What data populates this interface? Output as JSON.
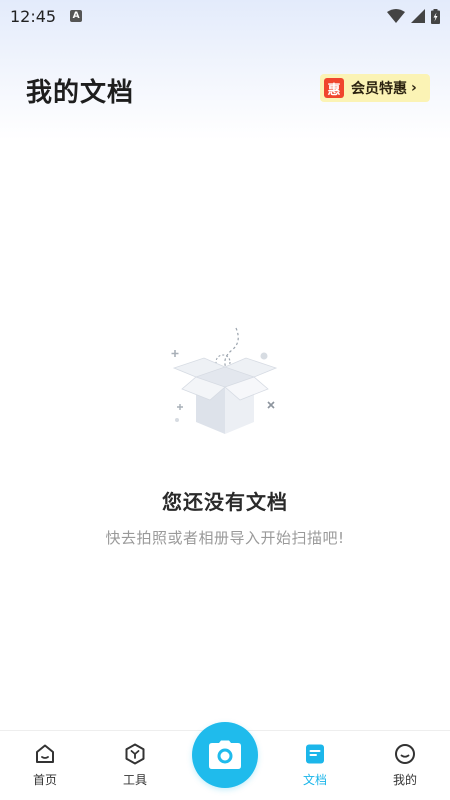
{
  "status_bar": {
    "time": "12:45",
    "notification_icon": "a-icon",
    "icons": [
      "wifi-icon",
      "signal-icon",
      "battery-icon"
    ]
  },
  "header": {
    "title": "我的文档",
    "promo": {
      "badge": "惠",
      "label": "会员特惠",
      "chevron": "›"
    }
  },
  "empty_state": {
    "illustration": "empty-box-icon",
    "title": "您还没有文档",
    "subtitle": "快去拍照或者相册导入开始扫描吧!"
  },
  "bottom_nav": {
    "items": [
      {
        "label": "首页",
        "icon": "home-icon",
        "active": false
      },
      {
        "label": "工具",
        "icon": "tools-icon",
        "active": false
      },
      {
        "label": "文档",
        "icon": "document-icon",
        "active": true
      },
      {
        "label": "我的",
        "icon": "profile-icon",
        "active": false
      }
    ],
    "camera_icon": "camera-icon"
  },
  "colors": {
    "accent": "#1fbbec",
    "promo_bg": "#fbf3b5",
    "promo_badge": "#f0452d",
    "subtitle_gray": "#9a9a9a"
  }
}
